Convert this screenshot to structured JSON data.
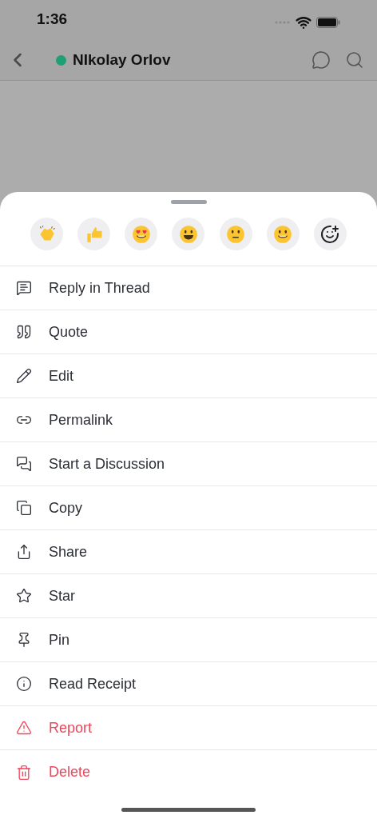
{
  "status_bar": {
    "time": "1:36"
  },
  "header": {
    "title": "NIkolay Orlov",
    "online": true
  },
  "menu": [
    {
      "label": "Reply in Thread",
      "destructive": false
    },
    {
      "label": "Quote",
      "destructive": false
    },
    {
      "label": "Edit",
      "destructive": false
    },
    {
      "label": "Permalink",
      "destructive": false
    },
    {
      "label": "Start a Discussion",
      "destructive": false
    },
    {
      "label": "Copy",
      "destructive": false
    },
    {
      "label": "Share",
      "destructive": false
    },
    {
      "label": "Star",
      "destructive": false
    },
    {
      "label": "Pin",
      "destructive": false
    },
    {
      "label": "Read Receipt",
      "destructive": false
    },
    {
      "label": "Report",
      "destructive": true
    },
    {
      "label": "Delete",
      "destructive": true
    }
  ]
}
